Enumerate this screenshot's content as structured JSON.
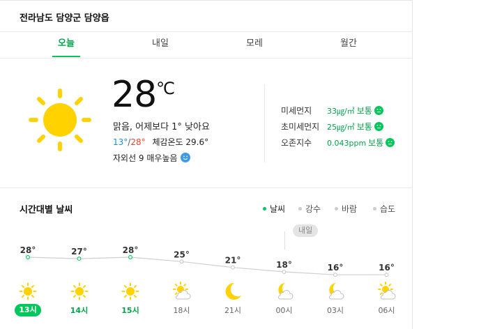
{
  "location": "전라남도 담양군 담양읍",
  "tabs": [
    {
      "label": "오늘",
      "active": true
    },
    {
      "label": "내일",
      "active": false
    },
    {
      "label": "모레",
      "active": false
    },
    {
      "label": "월간",
      "active": false
    }
  ],
  "current": {
    "temp": "28",
    "unit": "℃",
    "summary": "맑음, 어제보다 1° 낮아요",
    "min": "13°",
    "max": "28°",
    "feels_like": "체감온도 29.6°",
    "uv": "자외선 9 매우높음",
    "icon": "sun-icon"
  },
  "air": [
    {
      "label": "미세먼지",
      "value": "33㎍/㎥",
      "status": "보통",
      "icon": "neutral-face-icon"
    },
    {
      "label": "초미세먼지",
      "value": "25㎍/㎥",
      "status": "보통",
      "icon": "neutral-face-icon"
    },
    {
      "label": "오존지수",
      "value": "0.043ppm",
      "status": "보통",
      "icon": "neutral-face-icon"
    }
  ],
  "hourly": {
    "title": "시간대별 날씨",
    "legend": [
      {
        "label": "날씨",
        "active": true
      },
      {
        "label": "강수",
        "active": false
      },
      {
        "label": "바람",
        "active": false
      },
      {
        "label": "습도",
        "active": false
      }
    ],
    "tomorrow_label": "내일",
    "hours": [
      {
        "time": "13시",
        "temp": "28°",
        "value": 28,
        "icon": "sun-icon",
        "today": true,
        "now": true
      },
      {
        "time": "14시",
        "temp": "27°",
        "value": 27,
        "icon": "sun-icon",
        "today": true,
        "now": false
      },
      {
        "time": "15시",
        "temp": "28°",
        "value": 28,
        "icon": "sun-icon",
        "today": true,
        "now": false
      },
      {
        "time": "18시",
        "temp": "25°",
        "value": 25,
        "icon": "sun-cloud-icon",
        "today": false,
        "now": false
      },
      {
        "time": "21시",
        "temp": "21°",
        "value": 21,
        "icon": "moon-icon",
        "today": false,
        "now": false
      },
      {
        "time": "00시",
        "temp": "18°",
        "value": 18,
        "icon": "moon-cloud-icon",
        "today": false,
        "now": false
      },
      {
        "time": "03시",
        "temp": "16°",
        "value": 16,
        "icon": "moon-cloud-icon",
        "today": false,
        "now": false
      },
      {
        "time": "06시",
        "temp": "16°",
        "value": 16,
        "icon": "sun-cloud-icon",
        "today": false,
        "now": false
      }
    ]
  },
  "colors": {
    "accent": "#03c75a",
    "sun": "#ffd200",
    "min": "#1e8cdc",
    "max": "#f0412e"
  }
}
